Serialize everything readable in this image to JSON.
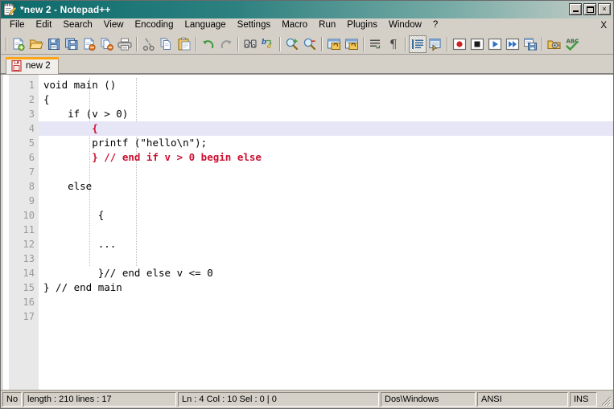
{
  "window": {
    "title": "*new  2 - Notepad++",
    "icon": "notepad-pencil-icon",
    "controls": {
      "minimize": "minimize-button",
      "maximize": "maximize-button",
      "close": "close-button",
      "close_glyph": "×"
    }
  },
  "menu": {
    "items": [
      {
        "label": "File"
      },
      {
        "label": "Edit"
      },
      {
        "label": "Search"
      },
      {
        "label": "View"
      },
      {
        "label": "Encoding"
      },
      {
        "label": "Language"
      },
      {
        "label": "Settings"
      },
      {
        "label": "Macro"
      },
      {
        "label": "Run"
      },
      {
        "label": "Plugins"
      },
      {
        "label": "Window"
      },
      {
        "label": "?"
      }
    ],
    "close_document_label": "X"
  },
  "toolbar": {
    "groups": [
      [
        "new-file-icon",
        "open-file-icon",
        "save-icon",
        "save-all-icon",
        "close-file-icon",
        "close-all-files-icon",
        "print-icon"
      ],
      [
        "cut-icon",
        "copy-icon",
        "paste-icon"
      ],
      [
        "undo-icon",
        "redo-icon"
      ],
      [
        "find-icon",
        "replace-icon"
      ],
      [
        "zoom-in-icon",
        "zoom-out-icon"
      ],
      [
        "sync-vertical-scroll-icon",
        "sync-horizontal-scroll-icon"
      ],
      [
        "word-wrap-icon",
        "show-all-characters-icon"
      ],
      [
        "show-indent-guide-icon",
        "ui-user-defined-dialog-icon"
      ],
      [
        "record-macro-icon",
        "stop-recording-icon",
        "playback-macro-icon",
        "run-multi-macro-icon",
        "save-macro-icon"
      ],
      [
        "run-icon",
        "spell-check-icon"
      ]
    ]
  },
  "tabs": [
    {
      "label": "new 2",
      "icon": "unsaved-document-icon",
      "active": true
    }
  ],
  "editor": {
    "line_count": 17,
    "current_line": 4,
    "lines": [
      {
        "n": 1,
        "text": "void main ()"
      },
      {
        "n": 2,
        "text": "{"
      },
      {
        "n": 3,
        "text": "    if (v > 0)"
      },
      {
        "n": 4,
        "text": "        {",
        "red_brace": true
      },
      {
        "n": 5,
        "text": "        printf (\"hello\\n\");"
      },
      {
        "n": 6,
        "text": "        } // end if v > 0 begin else",
        "red_brace": true
      },
      {
        "n": 7,
        "text": ""
      },
      {
        "n": 8,
        "text": "    else"
      },
      {
        "n": 9,
        "text": ""
      },
      {
        "n": 10,
        "text": "         {"
      },
      {
        "n": 11,
        "text": ""
      },
      {
        "n": 12,
        "text": "         ..."
      },
      {
        "n": 13,
        "text": ""
      },
      {
        "n": 14,
        "text": "         }// end else v <= 0"
      },
      {
        "n": 15,
        "text": "} // end main"
      },
      {
        "n": 16,
        "text": ""
      },
      {
        "n": 17,
        "text": ""
      }
    ]
  },
  "statusbar": {
    "doc_type": "No",
    "length_lines": "length : 210    lines : 17",
    "position": "Ln : 4    Col : 10    Sel : 0 | 0",
    "eol": "Dos\\Windows",
    "encoding": "ANSI",
    "insert_mode": "INS"
  },
  "colors": {
    "title_bar_left": "#0c6b6b",
    "chrome": "#d4d0c8",
    "tab_active_bar": "#ffa515",
    "current_line_highlight": "#e6e6f7",
    "brace_match_red": "#cc1133",
    "line_number_text": "#9a9a9a",
    "gutter_bg": "#e8e8e8"
  }
}
